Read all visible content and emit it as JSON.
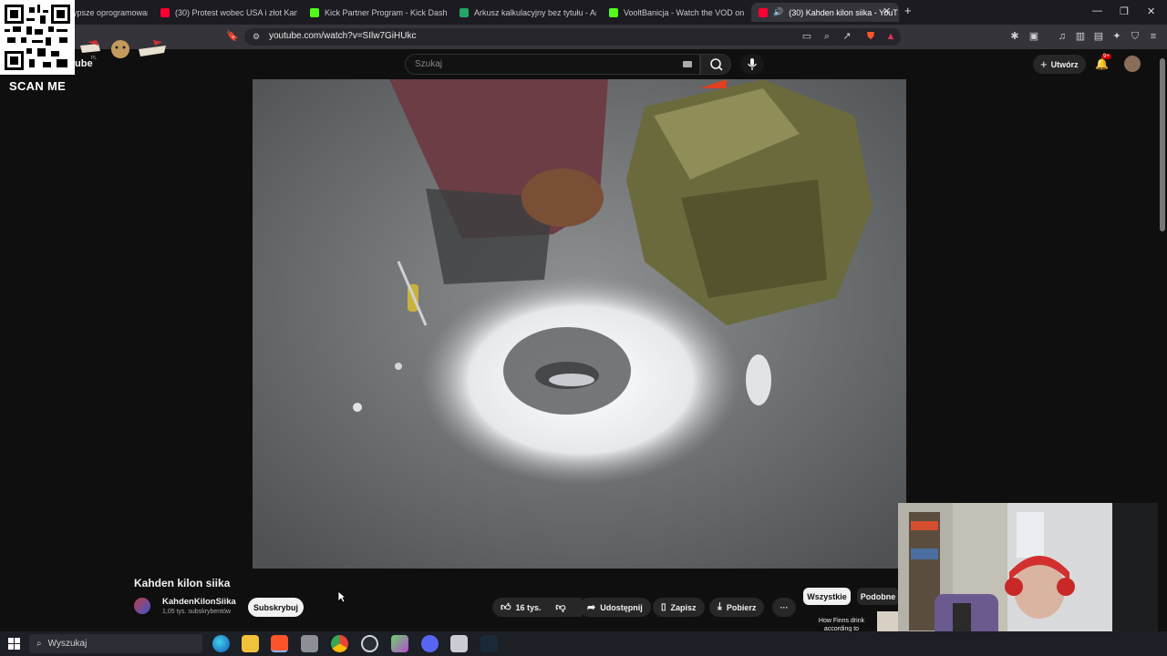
{
  "browser": {
    "tabs": [
      {
        "label": "ypsze oprogramowan"
      },
      {
        "label": "(30) Protest wobec USA i złot Kamrat"
      },
      {
        "label": "Kick Partner Program - Kick Dashboa"
      },
      {
        "label": "Arkusz kalkulacyjny bez tytułu - Arku"
      },
      {
        "label": "VooltBanicja - Watch the VOD on Kic"
      },
      {
        "label": "(30) Kahden kilon siika - YouT",
        "active": true
      }
    ],
    "new_tab": "+",
    "url": "youtube.com/watch?v=SIlw7GiHUkc"
  },
  "overlay": {
    "scan_me": "SCAN ME",
    "logo_partial": "ube",
    "logo_region": "PL"
  },
  "youtube": {
    "search_placeholder": "Szukaj",
    "create_label": "Utwórz",
    "notifications_badge": "9+",
    "video": {
      "title": "Kahden kilon siika",
      "channel": "KahdenKilonSiika",
      "subscribers": "1,05 tys. subskrybentów",
      "subscribe_label": "Subskrybuj",
      "likes": "16 tys.",
      "share_label": "Udostępnij",
      "save_label": "Zapisz",
      "download_label": "Pobierz",
      "more_label": "···"
    },
    "chips": {
      "all": "Wszystkie",
      "similar": "Podobne"
    },
    "recommended_title": "How Finns drink according to"
  },
  "taskbar": {
    "search_label": "Wyszukaj"
  },
  "colors": {
    "tab_strip": "#1c1b22",
    "page_bg": "#0f0f0f",
    "youtube_red": "#ff0033",
    "brave_orange": "#fb542b"
  }
}
